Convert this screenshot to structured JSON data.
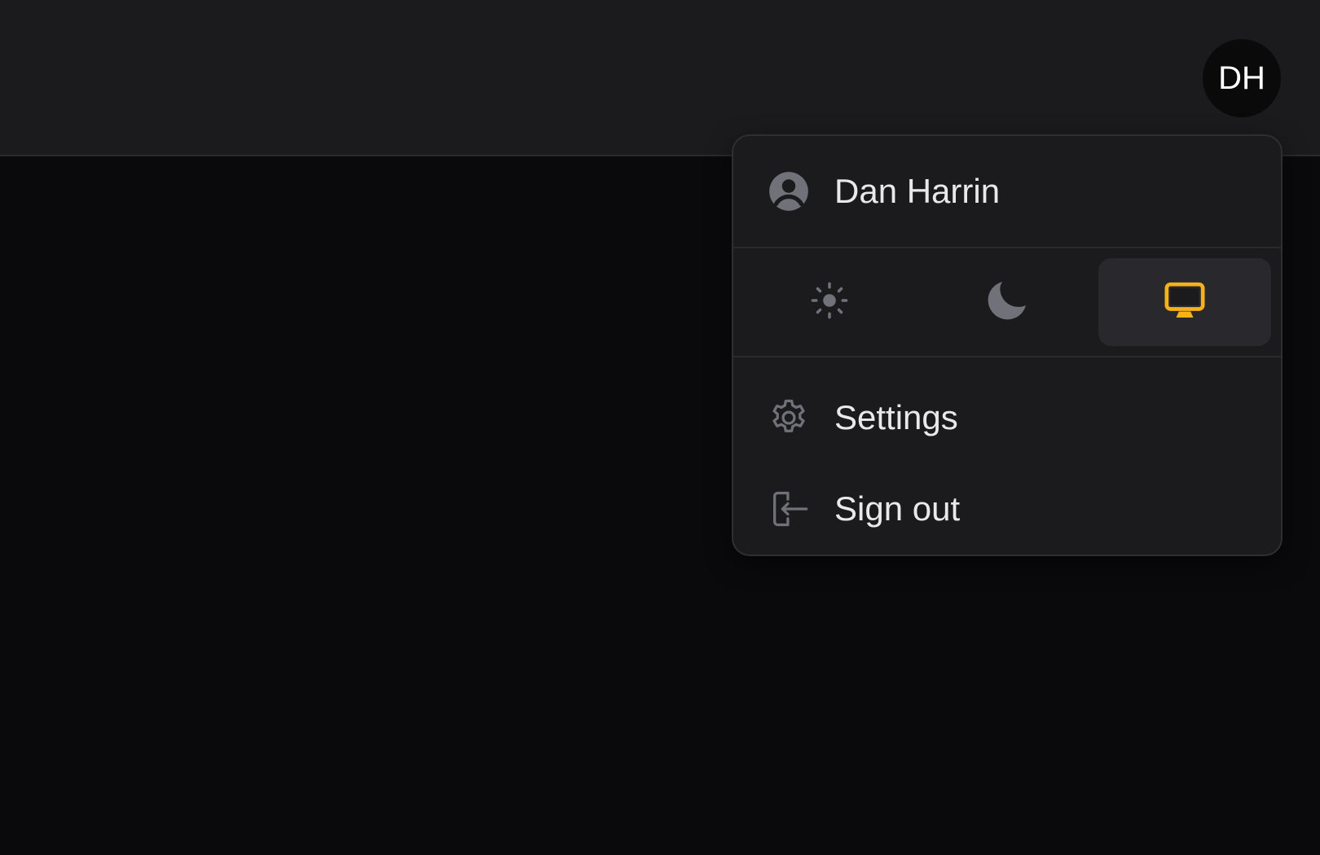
{
  "header": {
    "avatar_initials": "DH"
  },
  "user_menu": {
    "user_name": "Dan Harrin",
    "theme": {
      "options": [
        {
          "icon": "sun-icon",
          "state": "inactive"
        },
        {
          "icon": "moon-icon",
          "state": "inactive"
        },
        {
          "icon": "computer-desktop-icon",
          "state": "active"
        }
      ],
      "active_color": "#f7b21a",
      "inactive_color": "#71717a"
    },
    "items": [
      {
        "label": "Settings",
        "icon": "gear-icon"
      },
      {
        "label": "Sign out",
        "icon": "sign-out-icon"
      }
    ]
  }
}
